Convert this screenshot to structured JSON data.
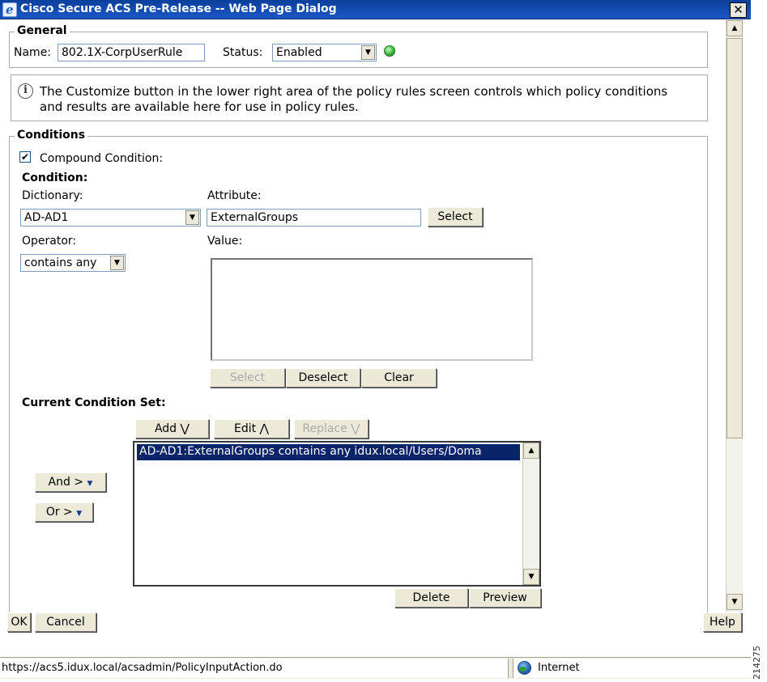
{
  "window": {
    "title": "Cisco Secure ACS Pre-Release -- Web Page Dialog",
    "close_label": "✕"
  },
  "general": {
    "legend": "General",
    "name_label": "Name:",
    "name_value": "802.1X-CorpUserRule",
    "status_label": "Status:",
    "status_value": "Enabled",
    "status_indicator_color": "#1fa01f"
  },
  "info": {
    "icon": "info-icon",
    "text": "The Customize button in the lower right area of the policy rules screen controls which policy conditions and results are available here for use in policy rules."
  },
  "conditions": {
    "legend": "Conditions",
    "compound_label": "Compound Condition:",
    "compound_checked": true,
    "condition_heading": "Condition:",
    "dictionary_label": "Dictionary:",
    "dictionary_value": "AD-AD1",
    "attribute_label": "Attribute:",
    "attribute_value": "ExternalGroups",
    "attribute_select": "Select",
    "operator_label": "Operator:",
    "operator_value": "contains any",
    "value_label": "Value:",
    "value_buttons": {
      "select": "Select",
      "deselect": "Deselect",
      "clear": "Clear"
    },
    "current_set_label": "Current Condition Set:",
    "set_buttons": {
      "add": "Add ⋁",
      "edit": "Edit ⋀",
      "replace": "Replace ⋁"
    },
    "and_button": "And >",
    "or_button": "Or >",
    "list_items": [
      "AD-AD1:ExternalGroups contains any idux.local/Users/Doma"
    ],
    "list_buttons": {
      "delete": "Delete",
      "preview": "Preview"
    }
  },
  "footer": {
    "ok": "OK",
    "cancel": "Cancel",
    "help": "Help"
  },
  "statusbar": {
    "url": "https://acs5.idux.local/acsadmin/PolicyInputAction.do",
    "zone": "Internet"
  },
  "side_code": "214275"
}
